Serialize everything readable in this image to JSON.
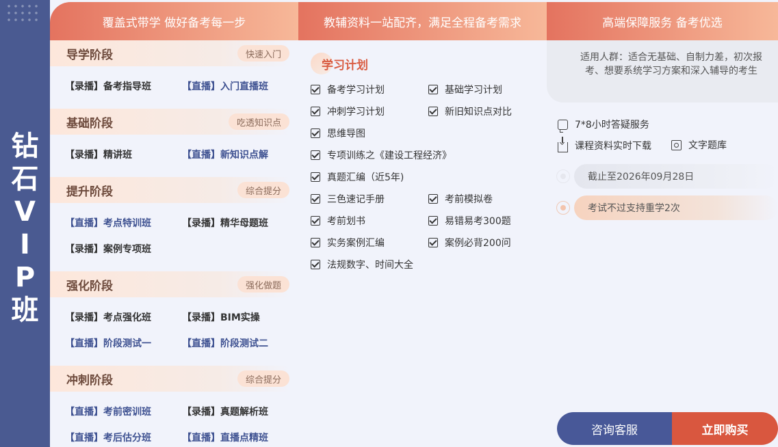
{
  "side": {
    "title_chars": [
      "钻",
      "石",
      "V",
      "I",
      "P",
      "班"
    ]
  },
  "headers": [
    "覆盖式带学 做好备考每一步",
    "教辅资料一站配齐，满足全程备考需求",
    "高端保障服务 备考优选"
  ],
  "stages": [
    {
      "title": "导学阶段",
      "tag": "快速入门",
      "courses": [
        {
          "label": "【录播】备考指导班",
          "kind": "rec"
        },
        {
          "label": "【直播】入门直播班",
          "kind": "live"
        }
      ]
    },
    {
      "title": "基础阶段",
      "tag": "吃透知识点",
      "courses": [
        {
          "label": "【录播】精讲班",
          "kind": "rec"
        },
        {
          "label": "【直播】新知识点解",
          "kind": "live"
        }
      ]
    },
    {
      "title": "提升阶段",
      "tag": "综合提分",
      "courses": [
        {
          "label": "【直播】考点特训班",
          "kind": "live"
        },
        {
          "label": "【录播】精华母题班",
          "kind": "rec"
        },
        {
          "label": "【录播】案例专项班",
          "kind": "rec"
        }
      ]
    },
    {
      "title": "强化阶段",
      "tag": "强化做题",
      "courses": [
        {
          "label": "【录播】考点强化班",
          "kind": "rec"
        },
        {
          "label": "【录播】BIM实操",
          "kind": "rec"
        },
        {
          "label": "【直播】阶段测试一",
          "kind": "live"
        },
        {
          "label": "【直播】阶段测试二",
          "kind": "live"
        }
      ]
    },
    {
      "title": "冲刺阶段",
      "tag": "综合提分",
      "courses": [
        {
          "label": "【直播】考前密训班",
          "kind": "live"
        },
        {
          "label": "【录播】真题解析班",
          "kind": "rec"
        },
        {
          "label": "【直播】考后估分班",
          "kind": "live"
        },
        {
          "label": "【直播】直播点精班",
          "kind": "live"
        }
      ]
    }
  ],
  "plan": {
    "title": "学习计划",
    "items": [
      "备考学习计划",
      "基础学习计划",
      "冲刺学习计划",
      "新旧知识点对比",
      "思维导图",
      "专项训练之《建设工程经济》",
      "真题汇编（近5年)",
      "三色速记手册",
      "考前模拟卷",
      "考前划书",
      "易错易考300题",
      "实务案例汇编",
      "案例必背200问",
      "法规数字、时间大全"
    ]
  },
  "service": {
    "audience": "适用人群：适合无基础、自制力差，初次报考、想要系统学习方案和深入辅导的考生",
    "items": [
      "7*8小时答疑服务",
      "课程资料实时下载",
      "文字题库"
    ],
    "deadline": "截止至2026年09月28日",
    "guarantee": "考试不过支持重学2次"
  },
  "buttons": {
    "consult": "咨询客服",
    "buy": "立即购买"
  }
}
